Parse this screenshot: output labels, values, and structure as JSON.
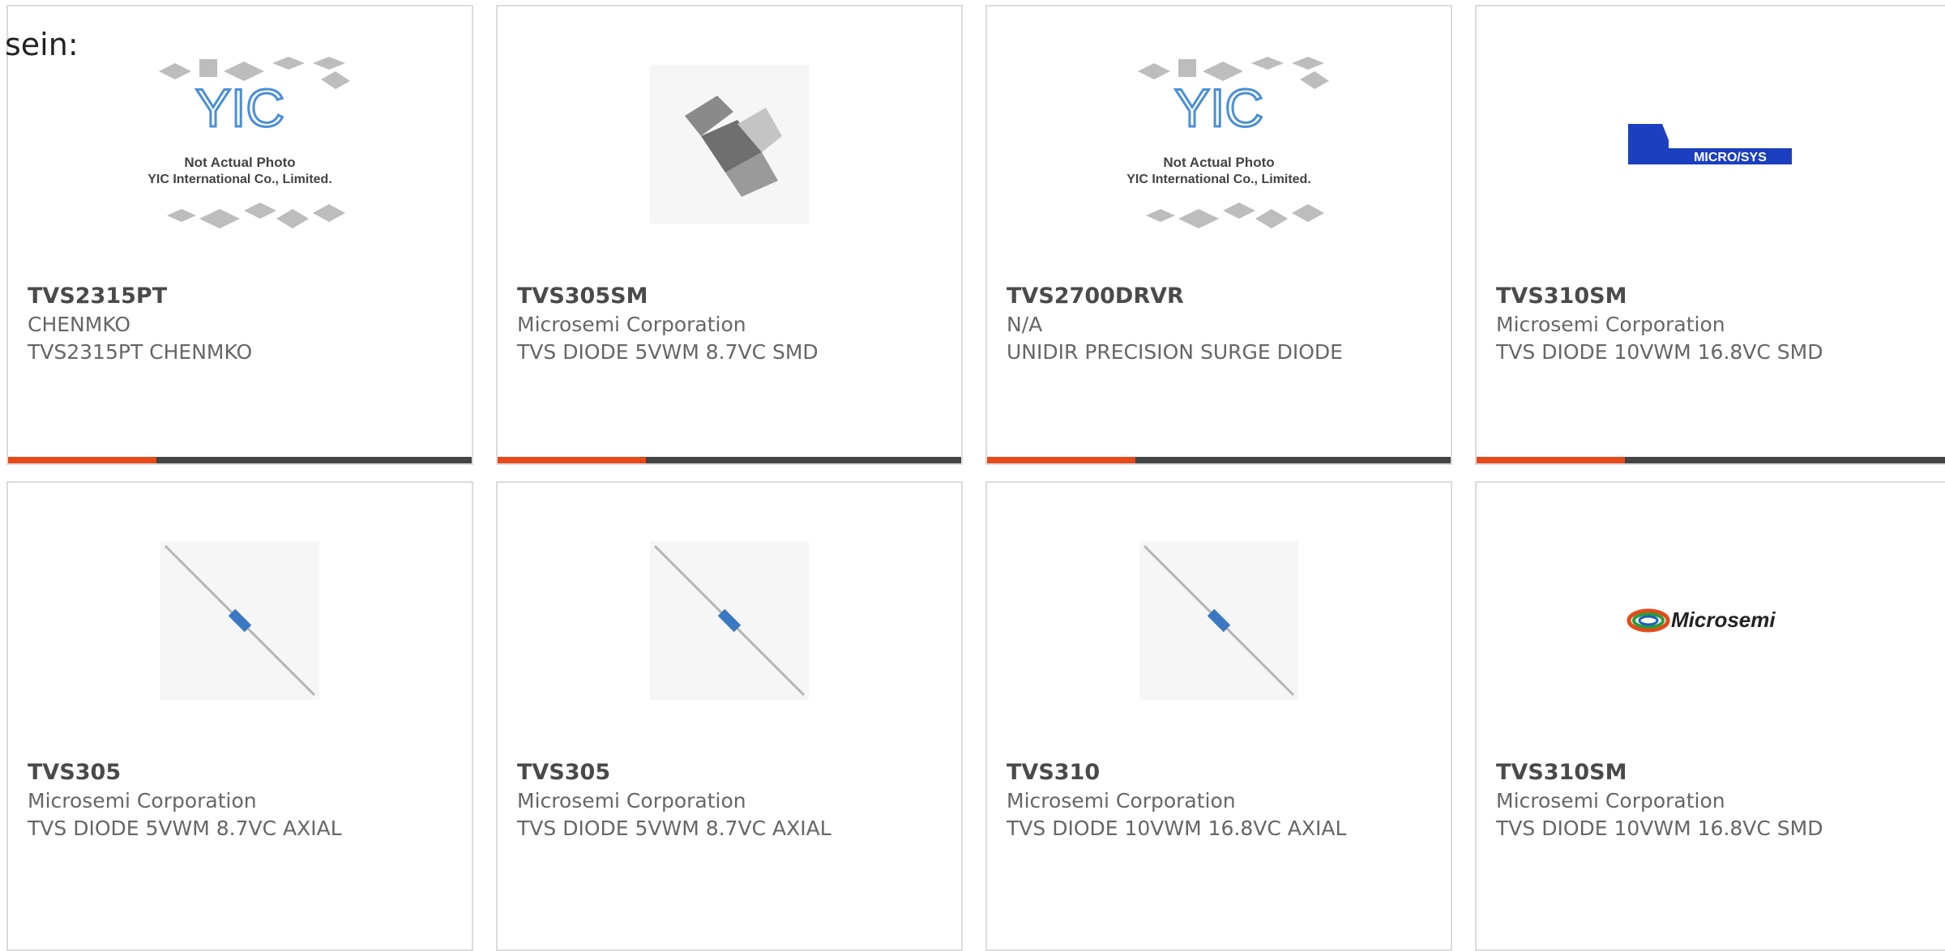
{
  "lead_text": "sein:",
  "colors": {
    "accent": "#e64a19",
    "bar_dark": "#444444",
    "micro_blue": "#1c3fbf"
  },
  "placeholder": {
    "line1": "Not Actual Photo",
    "line2": "YIC International Co., Limited.",
    "logo": "YIC"
  },
  "logos": {
    "microsys": "MICRO/SYS",
    "microsemi": "Microsemi"
  },
  "cards": [
    {
      "part": "TVS2315PT",
      "manufacturer": "CHENMKO",
      "description": "TVS2315PT CHENMKO",
      "image": "yic-placeholder-icon"
    },
    {
      "part": "TVS305SM",
      "manufacturer": "Microsemi Corporation",
      "description": "TVS DIODE 5VWM 8.7VC SMD",
      "image": "smd-diode-icon"
    },
    {
      "part": "TVS2700DRVR",
      "manufacturer": "N/A",
      "description": "UNIDIR PRECISION SURGE DIODE",
      "image": "yic-placeholder-icon"
    },
    {
      "part": "TVS310SM",
      "manufacturer": "Microsemi Corporation",
      "description": "TVS DIODE 10VWM 16.8VC SMD",
      "image": "microsys-logo"
    },
    {
      "part": "TVS305",
      "manufacturer": "Microsemi Corporation",
      "description": "TVS DIODE 5VWM 8.7VC AXIAL",
      "image": "axial-diode-icon"
    },
    {
      "part": "TVS305",
      "manufacturer": "Microsemi Corporation",
      "description": "TVS DIODE 5VWM 8.7VC AXIAL",
      "image": "axial-diode-icon"
    },
    {
      "part": "TVS310",
      "manufacturer": "Microsemi Corporation",
      "description": "TVS DIODE 10VWM 16.8VC AXIAL",
      "image": "axial-diode-icon"
    },
    {
      "part": "TVS310SM",
      "manufacturer": "Microsemi Corporation",
      "description": "TVS DIODE 10VWM 16.8VC SMD",
      "image": "microsemi-logo"
    }
  ]
}
